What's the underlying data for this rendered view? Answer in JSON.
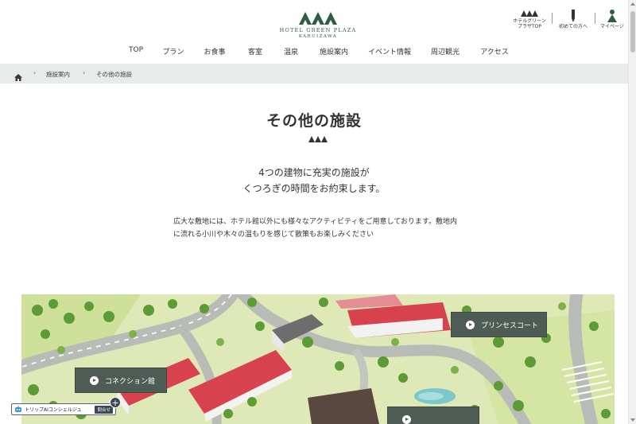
{
  "logo": {
    "name_line1": "HOTEL GREEN PLAZA",
    "name_line2": "KARUIZAWA",
    "brand_color": "#2c5e3f"
  },
  "utility_nav": {
    "top_label_line1": "ホテルグリーン",
    "top_label_line2": "プラザTOP",
    "first_time_label": "初めての方へ",
    "mypage_label": "マイページ"
  },
  "global_nav": {
    "items": [
      "TOP",
      "プラン",
      "お食事",
      "客室",
      "温泉",
      "施設案内",
      "イベント情報",
      "周辺観光",
      "アクセス"
    ]
  },
  "breadcrumb": {
    "items": [
      "施設案内",
      "その他の施設"
    ],
    "background": "#e7ebea"
  },
  "page": {
    "title": "その他の施設",
    "lead_line1": "4つの建物に充実の施設が",
    "lead_line2": "くつろぎの時間をお約束します。",
    "body_line1": "広大な敷地には、ホテル館以外にも様々なアクティビティをご用意しております。敷地内",
    "body_line2": "に流れる小川や木々の温もりを感じて散策もお楽しみください"
  },
  "map": {
    "buttons": {
      "princess_court": "プリンセスコート",
      "connection_hall": "コネクション館"
    },
    "button_color": "#4f5b55"
  },
  "concierge": {
    "label": "トリップAIコンシェルジュ",
    "badge": "問合せ",
    "plus": "+"
  },
  "icons": [
    "home-icon",
    "chevron-right-icon",
    "pencil-icon",
    "person-icon",
    "mountain-logo-icon",
    "play-icon",
    "robot-icon"
  ]
}
